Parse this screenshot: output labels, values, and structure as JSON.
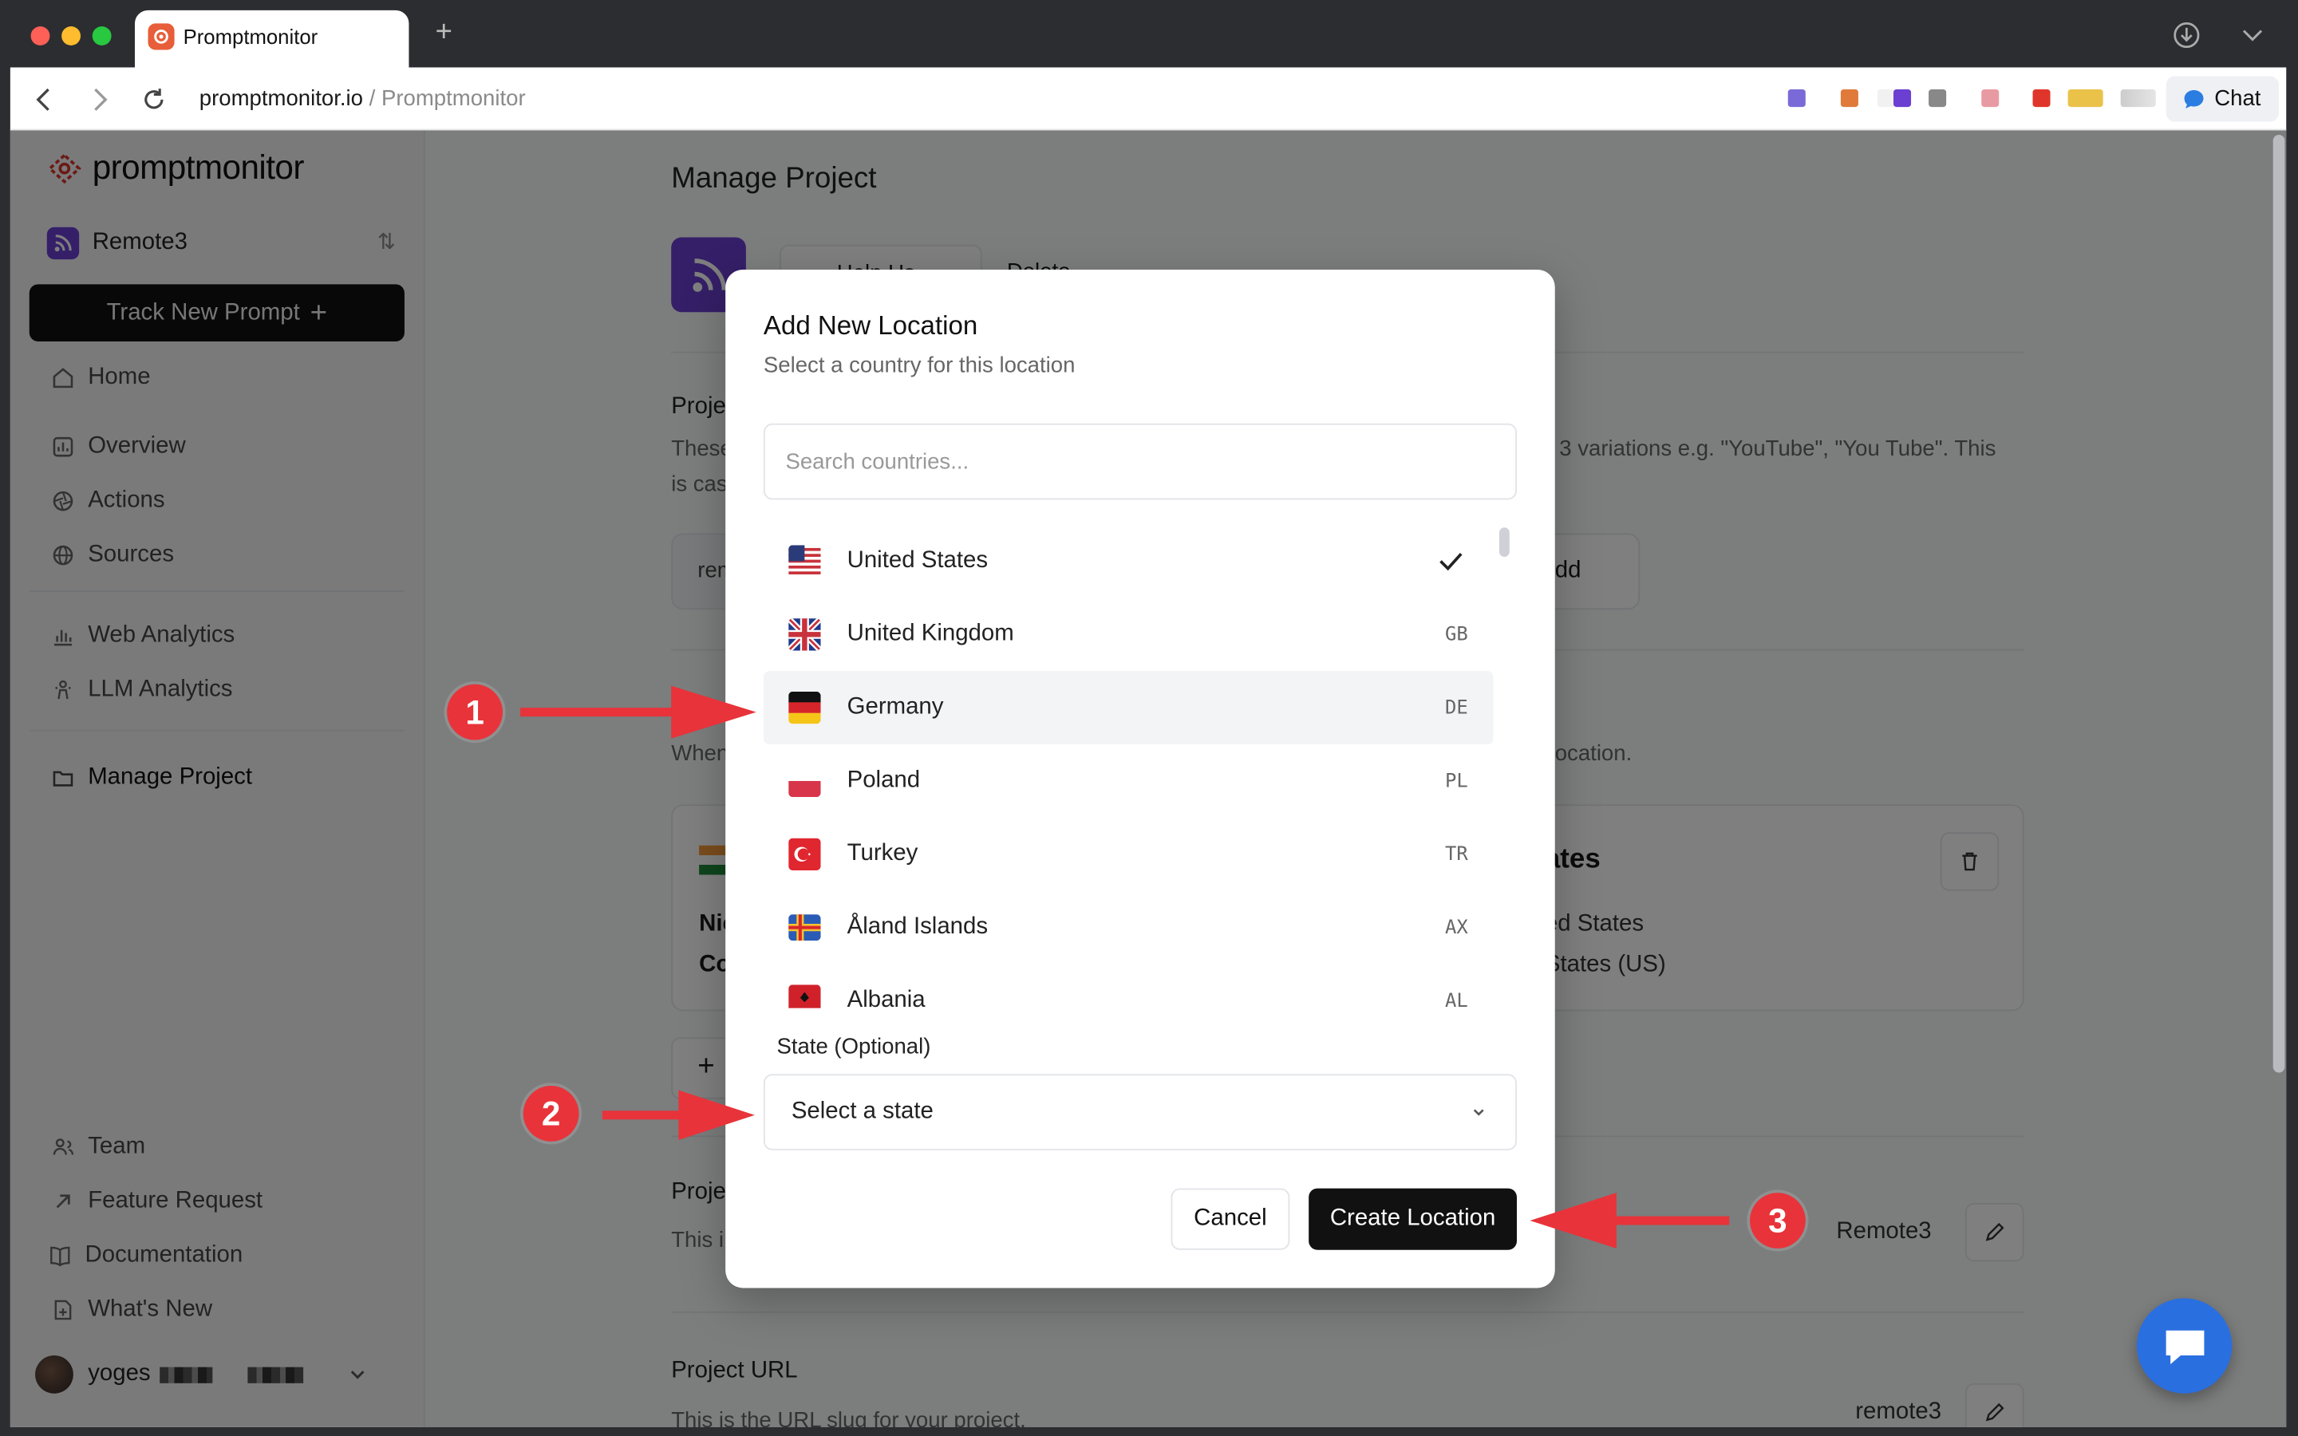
{
  "browser": {
    "tab_title": "Promptmonitor",
    "url_domain": "promptmonitor.io",
    "url_path": " / Promptmonitor",
    "chat_label": "Chat"
  },
  "sidebar": {
    "logo_text": "promptmonitor",
    "project_name": "Remote3",
    "track_button": "Track New Prompt",
    "nav": {
      "home": "Home",
      "overview": "Overview",
      "actions": "Actions",
      "sources": "Sources",
      "web_analytics": "Web Analytics",
      "llm_analytics": "LLM Analytics",
      "manage_project": "Manage Project",
      "team": "Team",
      "feature_request": "Feature Request",
      "documentation": "Documentation",
      "whats_new": "What's New"
    },
    "user_name": "yoges"
  },
  "main": {
    "title": "Manage Project",
    "help_btn": "Help Us",
    "delete_btn": "Delete",
    "section1_title": "Proje",
    "section1_desc_a": "These",
    "section1_desc_b": "3 variations e.g. \"YouTube\", \"You Tube\". This",
    "section1_desc_c": "is cas",
    "input_partial": "rem",
    "add_btn_partial": "dd",
    "section2_desc_a": "When",
    "section2_desc_b": "ocation.",
    "card_left_a": "Nic",
    "card_left_b": "Co",
    "card_right_title": "ates",
    "card_right_a": "ed States",
    "card_right_b": "States (US)",
    "add_partial": "+",
    "section3_title": "Proje",
    "section3_desc": "This i",
    "project_name_value": "Remote3",
    "url_title": "Project URL",
    "url_desc": "This is the URL slug for your project.",
    "url_value": "remote3"
  },
  "modal": {
    "title": "Add New Location",
    "subtitle": "Select a country for this location",
    "search_placeholder": "Search countries...",
    "countries": [
      {
        "name": "United States",
        "code": "",
        "selected": true
      },
      {
        "name": "United Kingdom",
        "code": "GB"
      },
      {
        "name": "Germany",
        "code": "DE",
        "highlighted": true
      },
      {
        "name": "Poland",
        "code": "PL"
      },
      {
        "name": "Turkey",
        "code": "TR"
      },
      {
        "name": "Åland Islands",
        "code": "AX"
      },
      {
        "name": "Albania",
        "code": "AL"
      }
    ],
    "state_label": "State (Optional)",
    "state_placeholder": "Select a state",
    "cancel": "Cancel",
    "create": "Create Location"
  },
  "annotations": [
    "1",
    "2",
    "3"
  ],
  "colors": {
    "accent": "#6b3fd1",
    "annotation": "#e8333a",
    "primary_button": "#111111",
    "chat_fab": "#2a6fe0"
  }
}
